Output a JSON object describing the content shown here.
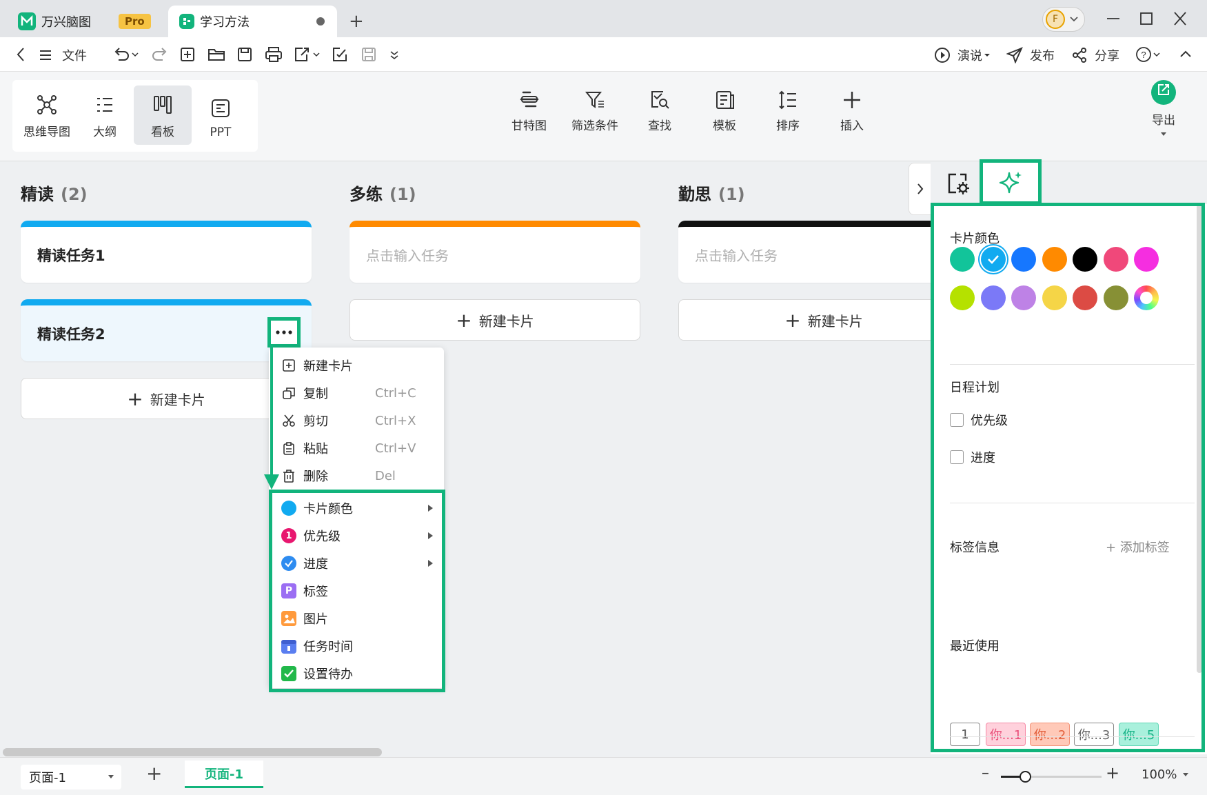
{
  "app": {
    "name": "万兴脑图",
    "badge": "Pro"
  },
  "document_tab": {
    "title": "学习方法"
  },
  "avatar_letter": "F",
  "menu": {
    "file": "文件",
    "present": "演说",
    "publish": "发布",
    "share": "分享"
  },
  "views": [
    {
      "label": "思维导图",
      "icon": "mindmap-icon",
      "active": false
    },
    {
      "label": "大纲",
      "icon": "outline-icon",
      "active": false
    },
    {
      "label": "看板",
      "icon": "kanban-icon",
      "active": true
    },
    {
      "label": "PPT",
      "icon": "ppt-icon",
      "active": false
    }
  ],
  "tools": [
    {
      "label": "甘特图",
      "icon": "gantt-icon"
    },
    {
      "label": "筛选条件",
      "icon": "filter-icon"
    },
    {
      "label": "查找",
      "icon": "search-icon"
    },
    {
      "label": "模板",
      "icon": "template-icon"
    },
    {
      "label": "排序",
      "icon": "sort-icon"
    },
    {
      "label": "插入",
      "icon": "plus-icon"
    }
  ],
  "export_label": "导出",
  "board": {
    "new_card_label": "新建卡片",
    "columns": [
      {
        "name": "精读",
        "count": "(2)",
        "color": "#11aaf0",
        "cards": [
          {
            "title": "精读任务1"
          },
          {
            "title": "精读任务2"
          }
        ]
      },
      {
        "name": "多练",
        "count": "(1)",
        "color": "#ff8a00",
        "cards": [
          {
            "placeholder": "点击输入任务"
          }
        ]
      },
      {
        "name": "勤思",
        "count": "(1)",
        "color": "#111111",
        "cards": [
          {
            "placeholder": "点击输入任务"
          }
        ]
      }
    ]
  },
  "context_menu": {
    "basic": [
      {
        "label": "新建卡片",
        "shortcut": "",
        "icon": "new-card-icon"
      },
      {
        "label": "复制",
        "shortcut": "Ctrl+C",
        "icon": "copy-icon"
      },
      {
        "label": "剪切",
        "shortcut": "Ctrl+X",
        "icon": "cut-icon"
      },
      {
        "label": "粘贴",
        "shortcut": "Ctrl+V",
        "icon": "paste-icon"
      },
      {
        "label": "删除",
        "shortcut": "Del",
        "icon": "delete-icon"
      }
    ],
    "attributes": [
      {
        "label": "卡片颜色",
        "submenu": true,
        "icon": "card-color-icon"
      },
      {
        "label": "优先级",
        "submenu": true,
        "icon": "priority-icon"
      },
      {
        "label": "进度",
        "submenu": true,
        "icon": "progress-icon"
      },
      {
        "label": "标签",
        "submenu": false,
        "icon": "tag-icon"
      },
      {
        "label": "图片",
        "submenu": false,
        "icon": "image-icon"
      },
      {
        "label": "任务时间",
        "submenu": false,
        "icon": "task-time-icon"
      },
      {
        "label": "设置待办",
        "submenu": false,
        "icon": "todo-icon"
      }
    ]
  },
  "panel": {
    "card_color_title": "卡片颜色",
    "colors": [
      "#12c49a",
      "#11aaf0",
      "#1677ff",
      "#ff8a00",
      "#000000",
      "#f0487a",
      "#f52ee0",
      "#b5e100",
      "#7b79f7",
      "#be82e6",
      "#f5d547",
      "#dc4b44",
      "#879035",
      "rainbow"
    ],
    "selected_color": "#11aaf0",
    "schedule_title": "日程计划",
    "priority_label": "优先级",
    "progress_label": "进度",
    "tags_title": "标签信息",
    "add_tag": "+ 添加标签",
    "recent_title": "最近使用",
    "recent_tags": [
      {
        "label": "1",
        "bg": "#ffffff",
        "border": "#888888",
        "fg": "#555555"
      },
      {
        "label": "你...1",
        "bg": "#ffd1dc",
        "border": "#f58aa6",
        "fg": "#e8507a"
      },
      {
        "label": "你...2",
        "bg": "#ffc9b8",
        "border": "#f39378",
        "fg": "#e2613d"
      },
      {
        "label": "你...3",
        "bg": "#ffffff",
        "border": "#888888",
        "fg": "#666666"
      },
      {
        "label": "你...5",
        "bg": "#a9f0dc",
        "border": "#5fd6b4",
        "fg": "#19b387"
      }
    ]
  },
  "status": {
    "page_select": "页面-1",
    "page_tab": "页面-1",
    "zoom": "100%"
  },
  "accent": "#12b47c"
}
